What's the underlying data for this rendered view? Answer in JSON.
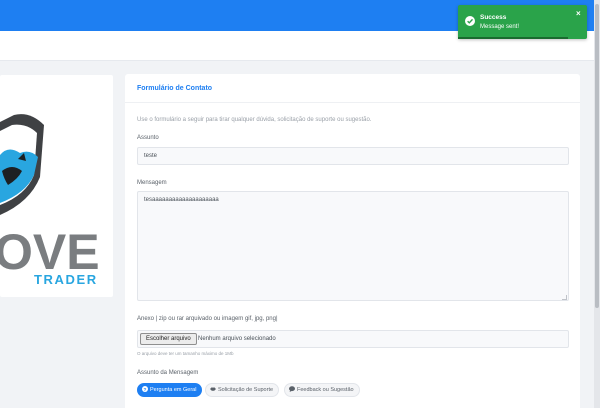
{
  "logo": {
    "brand_text": "OVE",
    "brand_sub": "TRADER"
  },
  "form": {
    "title": "Formulário de Contato",
    "intro": "Use o formulário a seguir para tirar qualquer dúvida, solicitação de suporte ou sugestão.",
    "subject_label": "Assunto",
    "subject_value": "teste",
    "message_label": "Mensagem",
    "message_value": "tesaaaaaaaaaaaaaaaaaaaa",
    "attachment_label": "Anexo | zip ou rar arquivado ou imagem gif, jpg, png|",
    "file_button": "Escolher arquivo",
    "file_status": "Nenhum arquivo selecionado",
    "attachment_hint": "O arquivo deve ter um tamanho máximo de 1Mb",
    "topic_label": "Assunto da Mensagem",
    "topics": [
      {
        "label": "Pergunta em Geral",
        "icon": "question-circle-icon",
        "active": true
      },
      {
        "label": "Solicitação de Suporte",
        "icon": "handshake-icon",
        "active": false
      },
      {
        "label": "Feedback ou Sugestão",
        "icon": "comment-icon",
        "active": false
      }
    ]
  },
  "toast": {
    "title": "Success",
    "message": "Message sent!",
    "close": "×",
    "icon": "check-circle-icon"
  },
  "colors": {
    "primary": "#1e7ff2",
    "success": "#2aa34a",
    "logo_blue": "#29a6e0",
    "logo_gray": "#7a7d80"
  }
}
